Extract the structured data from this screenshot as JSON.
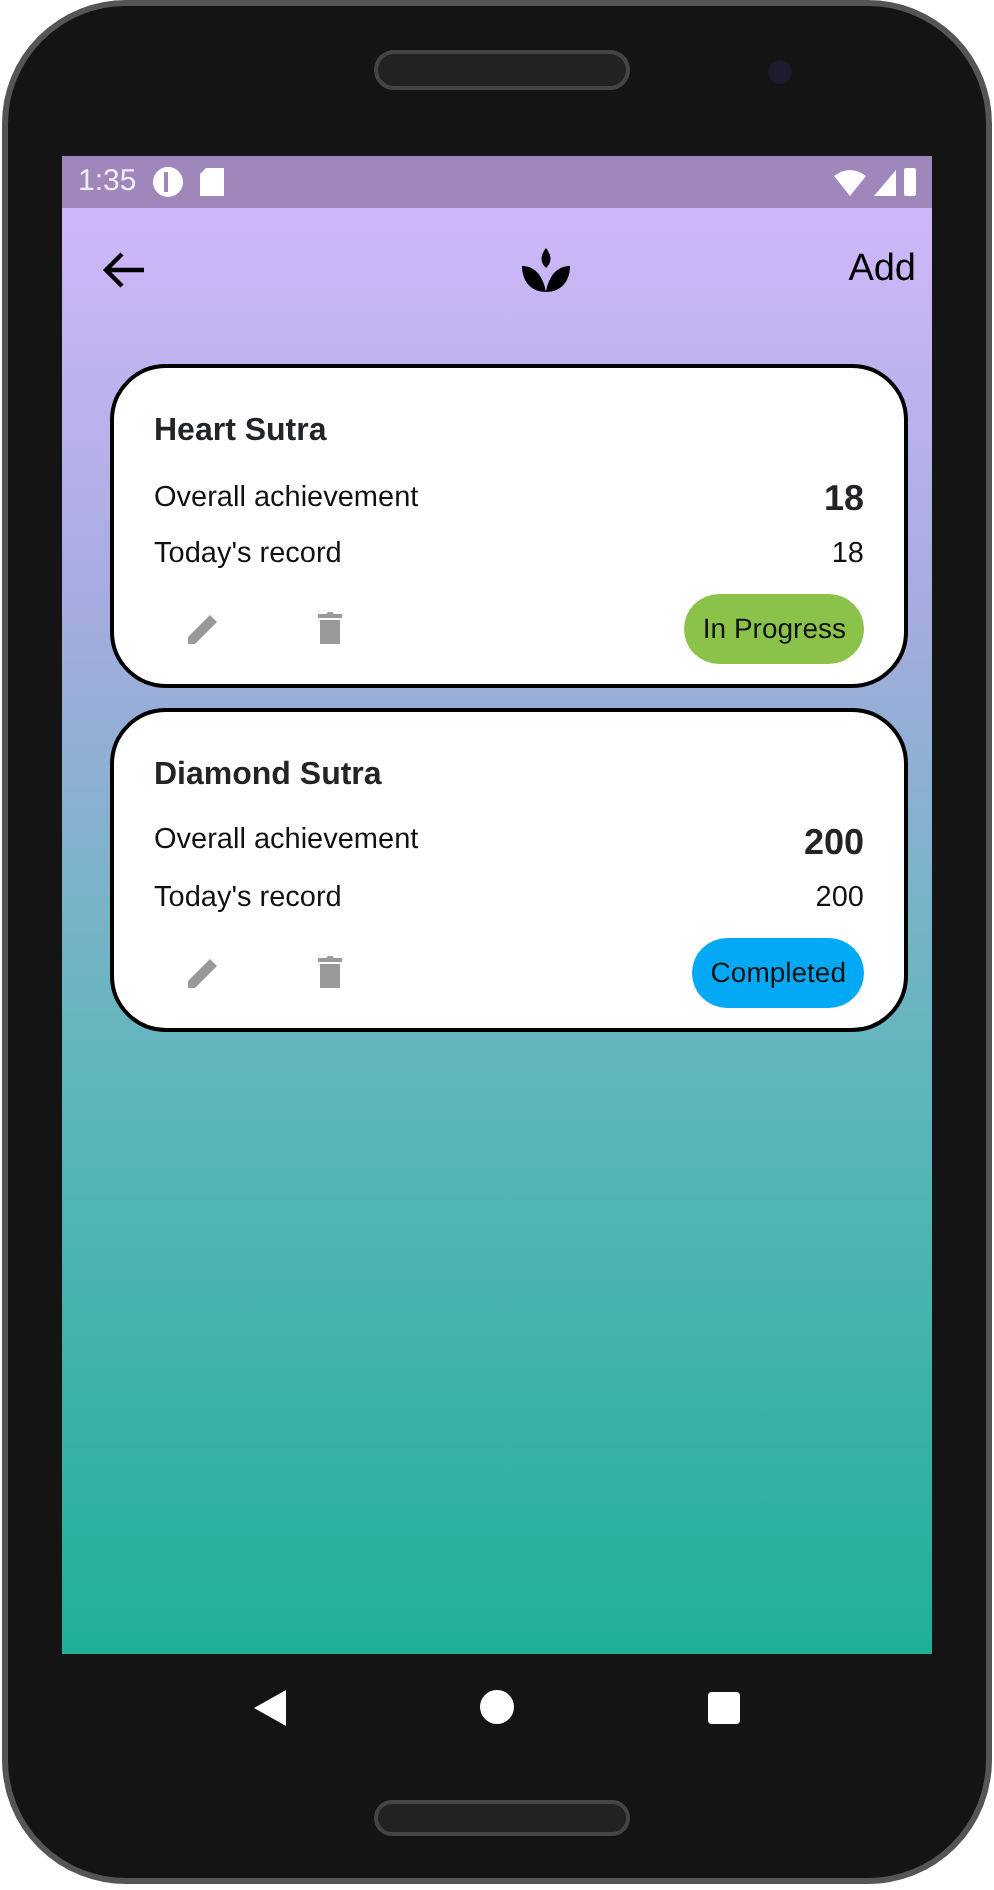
{
  "status_bar": {
    "time": "1:35"
  },
  "app_bar": {
    "action": "Add"
  },
  "records": [
    {
      "title": "Heart Sutra",
      "overall_label": "Overall achievement",
      "overall_value": "18",
      "today_label": "Today's record",
      "today_value": "18",
      "status": "In Progress",
      "color": "#8bc34a"
    },
    {
      "title": "Diamond Sutra",
      "overall_label": "Overall achievement",
      "overall_value": "200",
      "today_label": "Today's record",
      "today_value": "200",
      "status": "Completed",
      "color": "#03a9f4"
    }
  ]
}
